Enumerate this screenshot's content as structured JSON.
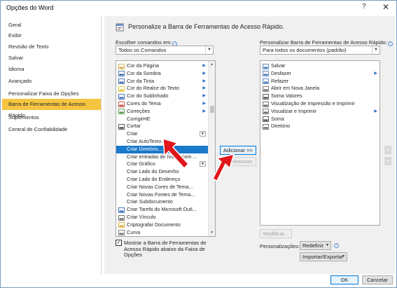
{
  "window": {
    "title": "Opções do Word",
    "help": "?",
    "close": "✕"
  },
  "nav": {
    "items": [
      {
        "label": "Geral"
      },
      {
        "label": "Exibir"
      },
      {
        "label": "Revisão de Texto"
      },
      {
        "label": "Salvar"
      },
      {
        "label": "Idioma"
      },
      {
        "label": "Avançado"
      },
      {
        "label": "Personalizar Faixa de Opções"
      },
      {
        "label": "Barra de Ferramentas de Acesso Rápido",
        "selected": true
      },
      {
        "label": "Suplementos"
      },
      {
        "label": "Central de Confiabilidade"
      }
    ]
  },
  "main": {
    "heading": "Personalize a Barra de Ferramentas de Acesso Rápido.",
    "choose_label": "Escolher comandos em:",
    "choose_value": "Todos os Comandos",
    "customize_label": "Personalizar Barra de Ferramentas de Acesso Rápido:",
    "customize_value": "Para todos os documentos (padrão)",
    "commands": [
      {
        "label": "Cor da Página",
        "icon": "page-color-icon",
        "sub": true
      },
      {
        "label": "Cor da Sombra",
        "icon": "shadow-color-icon",
        "sub": true
      },
      {
        "label": "Cor da Tinta",
        "icon": "ink-color-icon",
        "sub": true
      },
      {
        "label": "Cor do Realce do Texto",
        "icon": "highlight-icon",
        "sub": true
      },
      {
        "label": "Cor do Sublinhado",
        "icon": "underline-color-icon",
        "sub": true
      },
      {
        "label": "Cores do Tema",
        "icon": "theme-colors-icon",
        "sub": true
      },
      {
        "label": "Correções",
        "icon": "corrections-icon",
        "sub": true
      },
      {
        "label": "CorrigirHE",
        "icon": "",
        "sub": false
      },
      {
        "label": "Cortar",
        "icon": "crop-icon",
        "sub": false
      },
      {
        "label": "Criar",
        "icon": "",
        "drop": true
      },
      {
        "label": "Criar AutoTexto...",
        "icon": ""
      },
      {
        "label": "Criar Diretório...",
        "icon": "",
        "selected": true
      },
      {
        "label": "Criar entradas de índice com ...",
        "icon": ""
      },
      {
        "label": "Criar Gráfico",
        "icon": "",
        "drop": true
      },
      {
        "label": "Criar Lado do Desenho",
        "icon": ""
      },
      {
        "label": "Criar Lado do Endereço",
        "icon": ""
      },
      {
        "label": "Criar Novas Cores de Tema...",
        "icon": ""
      },
      {
        "label": "Criar Novas Fontes de Tema...",
        "icon": ""
      },
      {
        "label": "Criar Subdocumento",
        "icon": ""
      },
      {
        "label": "Criar Tarefa do Microsoft Outl...",
        "icon": "outlook-task-icon"
      },
      {
        "label": "Criar Vínculo",
        "icon": "link-icon"
      },
      {
        "label": "Criptografar Documento",
        "icon": "encrypt-icon"
      },
      {
        "label": "Curva",
        "icon": "curve-icon"
      }
    ],
    "toolbar_items": [
      {
        "label": "Salvar",
        "icon": "save-icon"
      },
      {
        "label": "Desfazer",
        "icon": "undo-icon",
        "sub": true
      },
      {
        "label": "Refazer",
        "icon": "redo-icon"
      },
      {
        "label": "Abrir em Nova Janela",
        "icon": "new-window-icon"
      },
      {
        "label": "Soma Valores",
        "icon": "sum-values-icon"
      },
      {
        "label": "Visualização de Impressão e Imprimir",
        "icon": "print-preview-icon"
      },
      {
        "label": "Visualizar e Imprimir",
        "icon": "preview-print-icon",
        "sub": true
      },
      {
        "label": "Soma",
        "icon": "sum-icon"
      },
      {
        "label": "Diretório",
        "icon": "directory-icon"
      }
    ],
    "add_button": "Adicionar >>",
    "remove_button": "<< Remover",
    "modify_button": "Modificar...",
    "show_below_label": "Mostrar a Barra de Ferramentas de Acesso Rápido abaixo da Faixa de Opções",
    "personalizations_label": "Personalizações:",
    "reset_button": "Redefinir",
    "import_export_button": "Importar/Exportar"
  },
  "footer": {
    "ok": "OK",
    "cancel": "Cancelar"
  },
  "colors": {
    "selected_nav": "#f5c542",
    "selected_row": "#1979ca",
    "arrow": "#e0161b"
  }
}
